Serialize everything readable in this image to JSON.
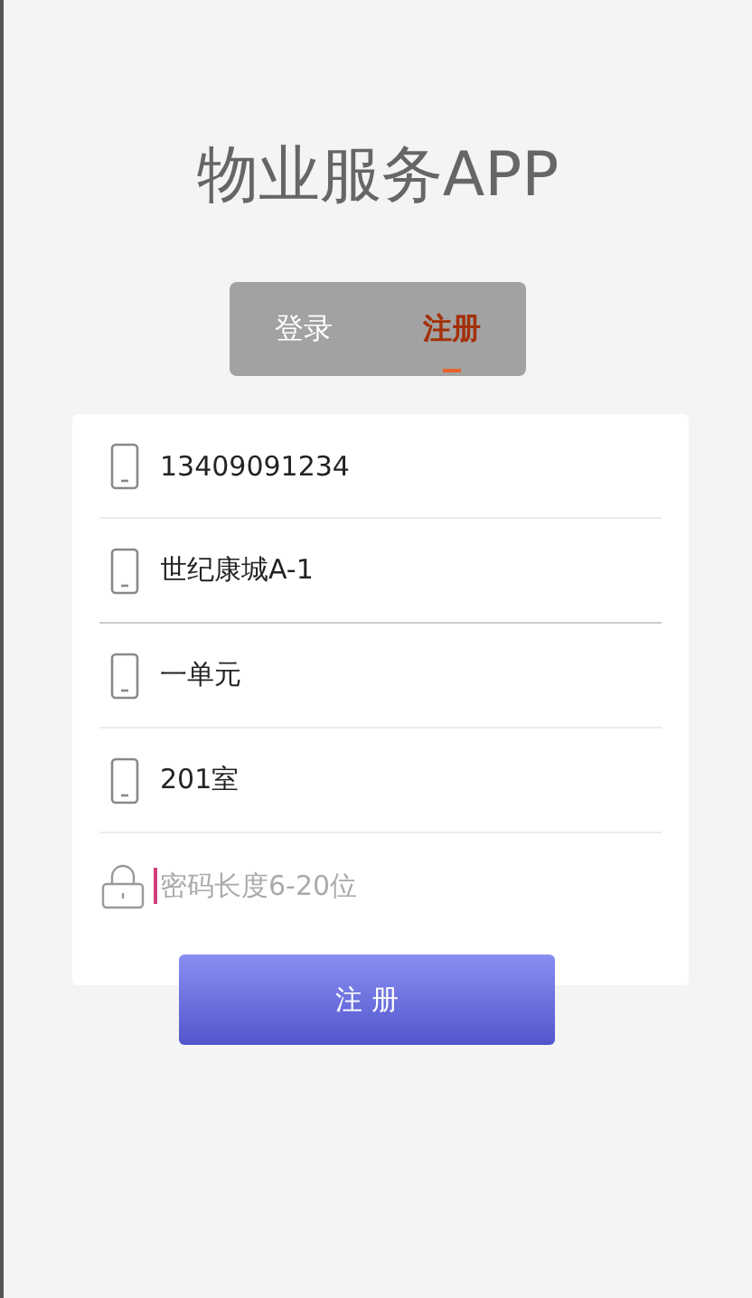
{
  "title": "物业服务APP",
  "tabs": [
    {
      "label": "登录",
      "selected": false
    },
    {
      "label": "注册",
      "selected": true
    }
  ],
  "fields": [
    {
      "kind": "phone",
      "value": "13409091234",
      "focused": false
    },
    {
      "kind": "phone",
      "value": "世纪康城A-1",
      "focused": false
    },
    {
      "kind": "phone",
      "value": "一单元",
      "focused": false
    },
    {
      "kind": "phone",
      "value": "201室",
      "focused": false
    },
    {
      "kind": "lock",
      "placeholder": "密码长度6-20位",
      "focused": true
    }
  ],
  "submit": "注 册"
}
